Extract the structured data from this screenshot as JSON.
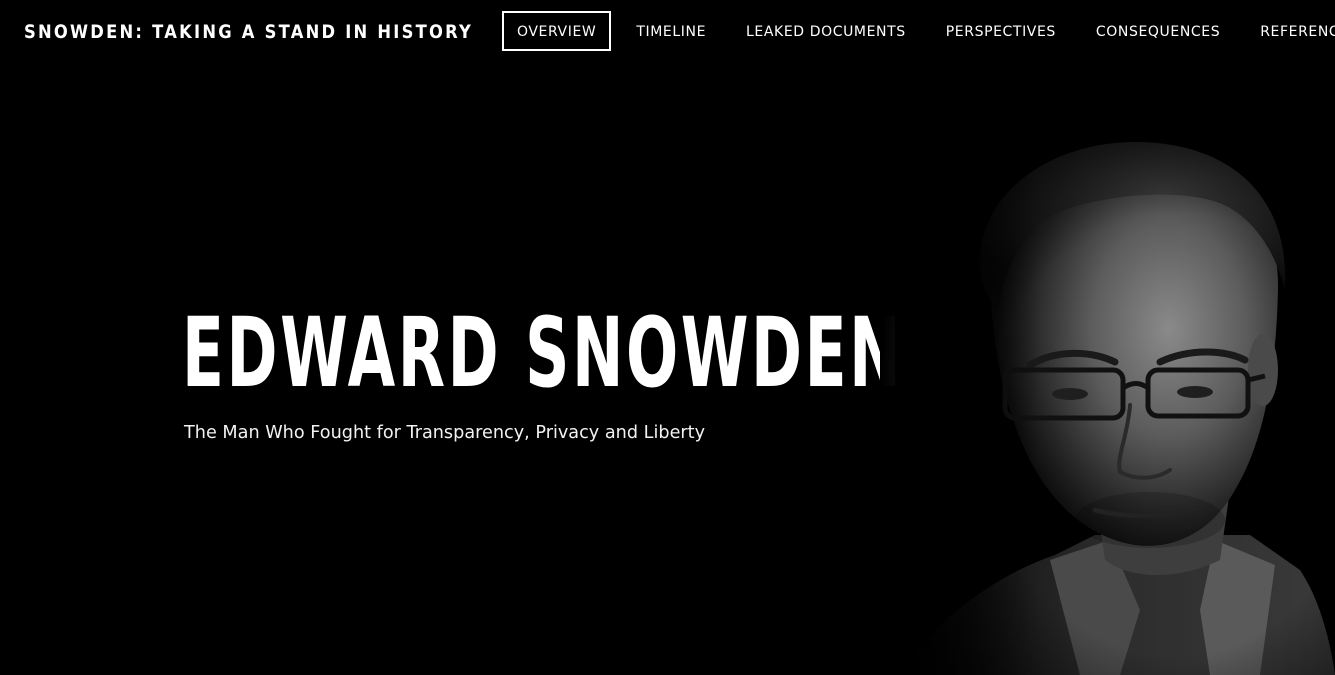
{
  "header": {
    "site_title": "SNOWDEN: TAKING A STAND IN HISTORY"
  },
  "nav": {
    "items": [
      {
        "label": "OVERVIEW",
        "active": true
      },
      {
        "label": "TIMELINE",
        "active": false
      },
      {
        "label": "LEAKED DOCUMENTS",
        "active": false
      },
      {
        "label": "PERSPECTIVES",
        "active": false
      },
      {
        "label": "CONSEQUENCES",
        "active": false
      },
      {
        "label": "REFERENCE",
        "active": false
      }
    ]
  },
  "hero": {
    "title": "EDWARD SNOWDEN",
    "subtitle": "The Man Who Fought for Transparency, Privacy and Liberty"
  },
  "colors": {
    "background": "#000000",
    "text": "#ffffff"
  }
}
